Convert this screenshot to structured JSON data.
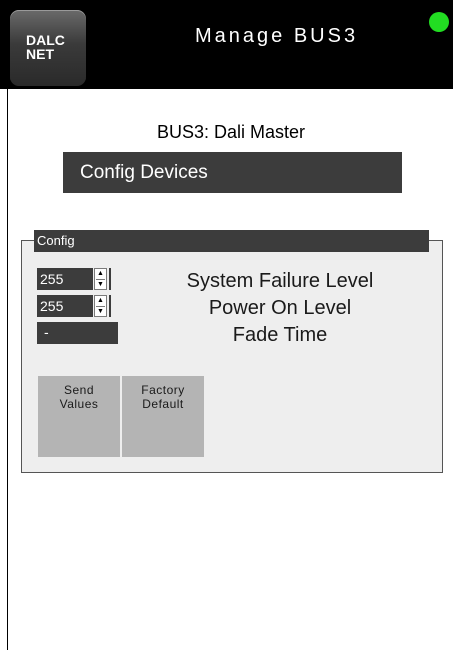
{
  "header": {
    "logo_line1": "DALC",
    "logo_line2": "NET",
    "title": "Manage BUS3",
    "status_color": "#22dd22"
  },
  "bus_title": "BUS3: Dali Master",
  "config_devices_button": "Config Devices",
  "config_panel": {
    "title": "Config",
    "system_failure_level": {
      "value": "255",
      "label": "System Failure Level"
    },
    "power_on_level": {
      "value": "255",
      "label": "Power On Level"
    },
    "fade_time": {
      "value": "-",
      "label": "Fade Time"
    },
    "send_values_line1": "Send",
    "send_values_line2": "Values",
    "factory_default_line1": "Factory",
    "factory_default_line2": "Default"
  },
  "icons": {
    "status": "status-dot-icon",
    "spin_up": "spin-up-icon",
    "spin_down": "spin-down-icon"
  }
}
